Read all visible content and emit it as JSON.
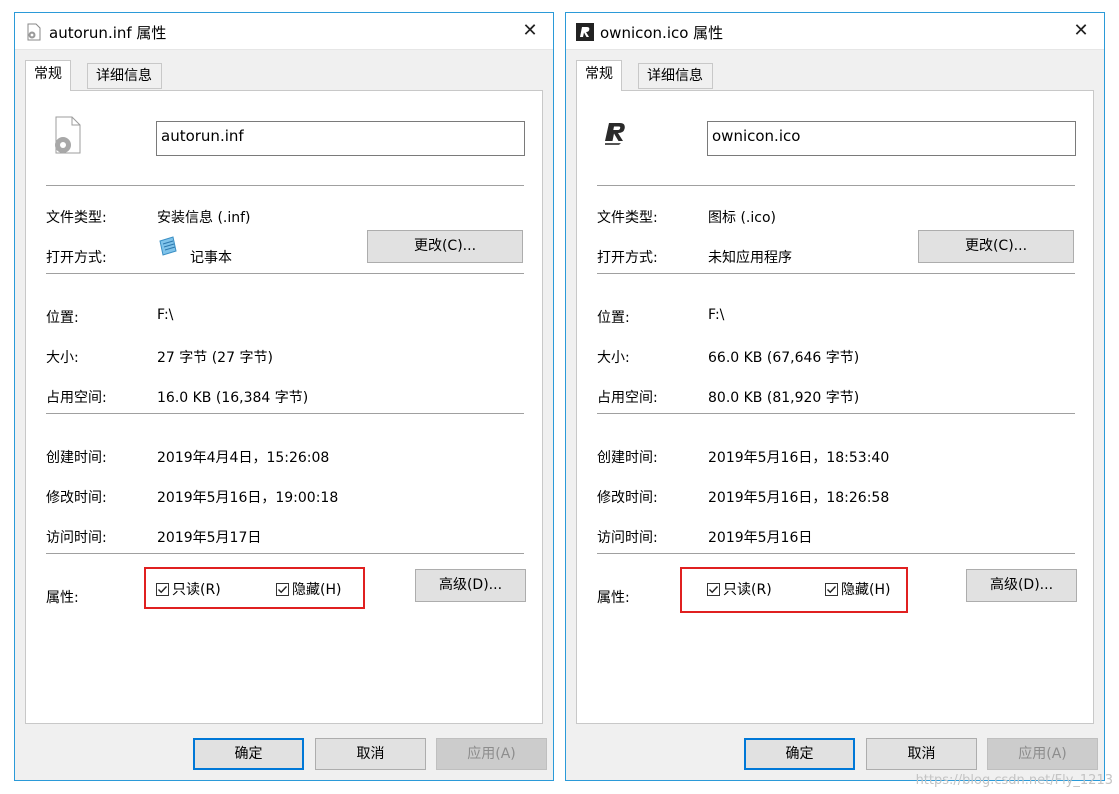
{
  "dialogs": [
    {
      "title": "autorun.inf 属性",
      "tabs": [
        "常规",
        "详细信息"
      ],
      "filename": "autorun.inf",
      "rows": {
        "type_label": "文件类型:",
        "type_value": "安装信息 (.inf)",
        "open_label": "打开方式:",
        "open_value": "记事本",
        "change_btn": "更改(C)...",
        "location_label": "位置:",
        "location_value": "F:\\",
        "size_label": "大小:",
        "size_value": "27 字节 (27 字节)",
        "disk_label": "占用空间:",
        "disk_value": "16.0 KB (16,384 字节)",
        "created_label": "创建时间:",
        "created_value": "2019年4月4日，15:26:08",
        "modified_label": "修改时间:",
        "modified_value": "2019年5月16日，19:00:18",
        "accessed_label": "访问时间:",
        "accessed_value": "2019年5月17日",
        "attr_label": "属性:",
        "readonly": "只读(R)",
        "hidden": "隐藏(H)",
        "advanced_btn": "高级(D)..."
      },
      "buttons": {
        "ok": "确定",
        "cancel": "取消",
        "apply": "应用(A)"
      }
    },
    {
      "title": "ownicon.ico 属性",
      "tabs": [
        "常规",
        "详细信息"
      ],
      "filename": "ownicon.ico",
      "rows": {
        "type_label": "文件类型:",
        "type_value": "图标 (.ico)",
        "open_label": "打开方式:",
        "open_value": "未知应用程序",
        "change_btn": "更改(C)...",
        "location_label": "位置:",
        "location_value": "F:\\",
        "size_label": "大小:",
        "size_value": "66.0 KB (67,646 字节)",
        "disk_label": "占用空间:",
        "disk_value": "80.0 KB (81,920 字节)",
        "created_label": "创建时间:",
        "created_value": "2019年5月16日，18:53:40",
        "modified_label": "修改时间:",
        "modified_value": "2019年5月16日，18:26:58",
        "accessed_label": "访问时间:",
        "accessed_value": "2019年5月16日",
        "attr_label": "属性:",
        "readonly": "只读(R)",
        "hidden": "隐藏(H)",
        "advanced_btn": "高级(D)..."
      },
      "buttons": {
        "ok": "确定",
        "cancel": "取消",
        "apply": "应用(A)"
      }
    }
  ],
  "watermark": "https://blog.csdn.net/Fly_1213",
  "icons": {
    "close": "close-icon",
    "checkbox": "checkmark-icon",
    "notepad": "notepad-icon",
    "settings_file": "settings-file-icon",
    "r_logo": "r-logo-icon"
  }
}
